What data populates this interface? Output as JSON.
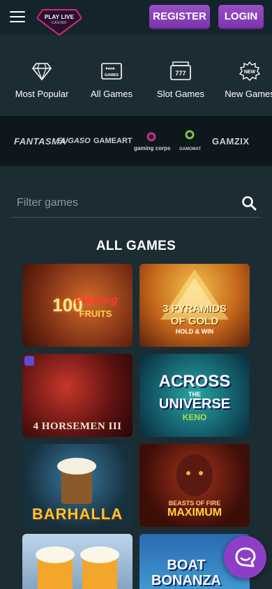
{
  "header": {
    "logo_line1": "PLAY LIVE",
    "logo_line2": "CASINO",
    "register_label": "REGISTER",
    "login_label": "LOGIN"
  },
  "categories": [
    {
      "label": "Most Popular",
      "icon": "diamond-icon"
    },
    {
      "label": "All Games",
      "icon": "cards-icon",
      "icon_text": "GAMES"
    },
    {
      "label": "Slot Games",
      "icon": "slot-machine-icon",
      "icon_text": "777"
    },
    {
      "label": "New Games",
      "icon": "new-badge-icon",
      "icon_text": "NEW"
    }
  ],
  "providers": [
    "FANTASMA",
    "EUGASO",
    "GAMEART",
    "gaming corps",
    "GAMOMAT",
    "GAMZIX"
  ],
  "filter": {
    "placeholder": "Filter games",
    "value": ""
  },
  "section_title": "ALL GAMES",
  "games": [
    {
      "title": "100 Flaming Fruits",
      "line1": "100",
      "line2": "Flaming",
      "line3": "FRUITS"
    },
    {
      "title": "3 Pyramids of Gold",
      "line1": "3 PYRAMIDS",
      "line2": "OF GOLD",
      "line3": "HOLD & WIN"
    },
    {
      "title": "4 Horsemen III",
      "line1": "4 HORSEMEN III"
    },
    {
      "title": "Across the Universe Keno",
      "line1": "ACROSS",
      "line2": "THE",
      "line3": "UNIVERSE",
      "line4": "KENO"
    },
    {
      "title": "Barhalla",
      "line1": "BARHALLA"
    },
    {
      "title": "Beasts of Fire Maximum",
      "line1": "BEASTS OF FIRE",
      "line2": "MAXIMUM"
    },
    {
      "title": "Beer game",
      "line1": ""
    },
    {
      "title": "Boat Bonanza",
      "line1": "BOAT",
      "line2": "BONANZA"
    }
  ],
  "colors": {
    "accent": "#8e3ec6",
    "background": "#1c2c33",
    "header": "#14242b"
  }
}
